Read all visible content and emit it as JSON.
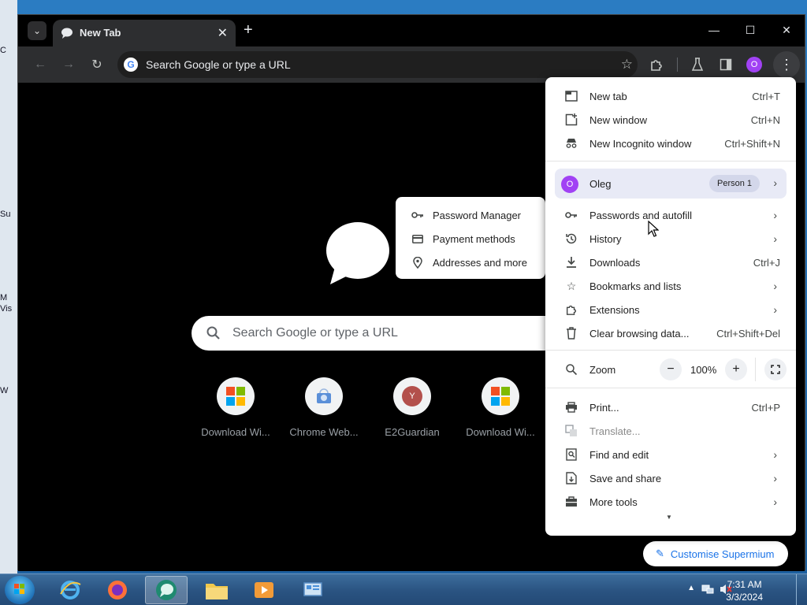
{
  "window": {
    "tab_title": "New Tab",
    "controls": {
      "minimize": "—",
      "maximize": "☐",
      "close": "✕"
    }
  },
  "toolbar": {
    "omnibox_placeholder": "Search Google or type a URL",
    "profile_initial": "O"
  },
  "ntp": {
    "search_placeholder": "Search Google or type a URL",
    "shortcuts": [
      {
        "label": "Download Wi...",
        "icon": "windows-logo-icon"
      },
      {
        "label": "Chrome Web...",
        "icon": "chrome-web-store-icon"
      },
      {
        "label": "E2Guardian",
        "icon": "e2guardian-icon",
        "initial": "Y"
      },
      {
        "label": "Download Wi...",
        "icon": "windows-logo-icon"
      }
    ],
    "customize_label": "Customise Supermium"
  },
  "menu": {
    "new_tab": {
      "label": "New tab",
      "shortcut": "Ctrl+T"
    },
    "new_window": {
      "label": "New window",
      "shortcut": "Ctrl+N"
    },
    "new_incognito": {
      "label": "New Incognito window",
      "shortcut": "Ctrl+Shift+N"
    },
    "profile": {
      "initial": "O",
      "name": "Oleg",
      "badge": "Person 1"
    },
    "passwords": {
      "label": "Passwords and autofill"
    },
    "history": {
      "label": "History"
    },
    "downloads": {
      "label": "Downloads",
      "shortcut": "Ctrl+J"
    },
    "bookmarks": {
      "label": "Bookmarks and lists"
    },
    "extensions": {
      "label": "Extensions"
    },
    "clear_data": {
      "label": "Clear browsing data...",
      "shortcut": "Ctrl+Shift+Del"
    },
    "zoom": {
      "label": "Zoom",
      "minus": "−",
      "value": "100%",
      "plus": "+"
    },
    "print": {
      "label": "Print...",
      "shortcut": "Ctrl+P"
    },
    "translate": {
      "label": "Translate..."
    },
    "find_edit": {
      "label": "Find and edit"
    },
    "save_share": {
      "label": "Save and share"
    },
    "more_tools": {
      "label": "More tools"
    }
  },
  "submenu": {
    "password_manager": "Password Manager",
    "payment_methods": "Payment methods",
    "addresses": "Addresses and more"
  },
  "taskbar": {
    "time": "7:31 AM",
    "date": "3/3/2024"
  },
  "desktop_fragments": [
    "C",
    "Su",
    "M",
    "Vis",
    "W"
  ]
}
